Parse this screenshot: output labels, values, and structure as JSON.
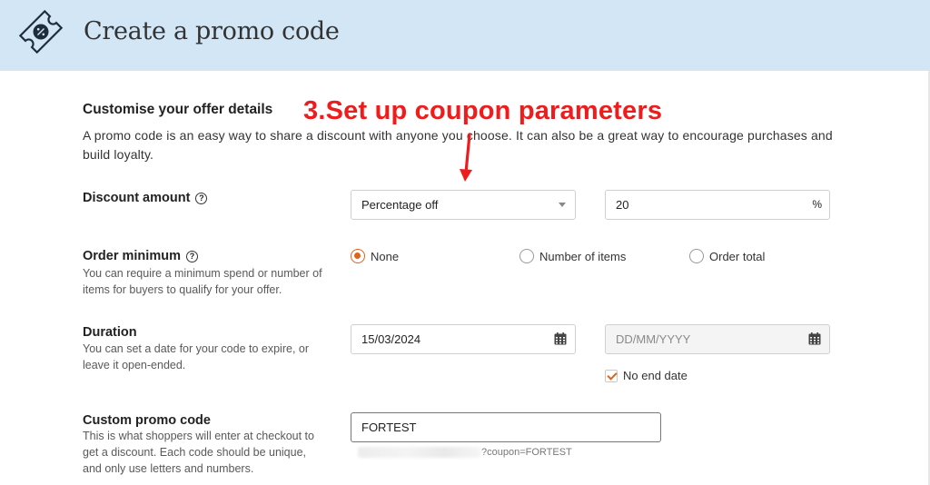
{
  "header": {
    "title": "Create a promo code",
    "icon": "ticket-discount-icon"
  },
  "annotation": {
    "text": "3.Set up coupon parameters",
    "color": "#ee1c1c"
  },
  "section": {
    "title": "Customise your offer details",
    "intro": "A promo code is an easy way to share a discount with anyone you choose. It can also be a great way to encourage purchases and build loyalty."
  },
  "discount": {
    "label": "Discount amount",
    "type_selected": "Percentage off",
    "amount_value": "20",
    "amount_suffix": "%"
  },
  "order_minimum": {
    "label": "Order minimum",
    "description": "You can require a minimum spend or number of items for buyers to qualify for your offer.",
    "options": [
      "None",
      "Number of items",
      "Order total"
    ],
    "selected": "None"
  },
  "duration": {
    "label": "Duration",
    "description": "You can set a date for your code to expire, or leave it open-ended.",
    "start_date": "15/03/2024",
    "end_placeholder": "DD/MM/YYYY",
    "no_end_label": "No end date",
    "no_end_checked": true
  },
  "promo": {
    "label": "Custom promo code",
    "description": "This is what shoppers will enter at checkout to get a discount. Each code should be unique, and only use letters and numbers.",
    "value": "FORTEST",
    "url_suffix": "?coupon=FORTEST"
  },
  "colors": {
    "header_bg": "#d2e6f5",
    "accent": "#e0621f"
  }
}
